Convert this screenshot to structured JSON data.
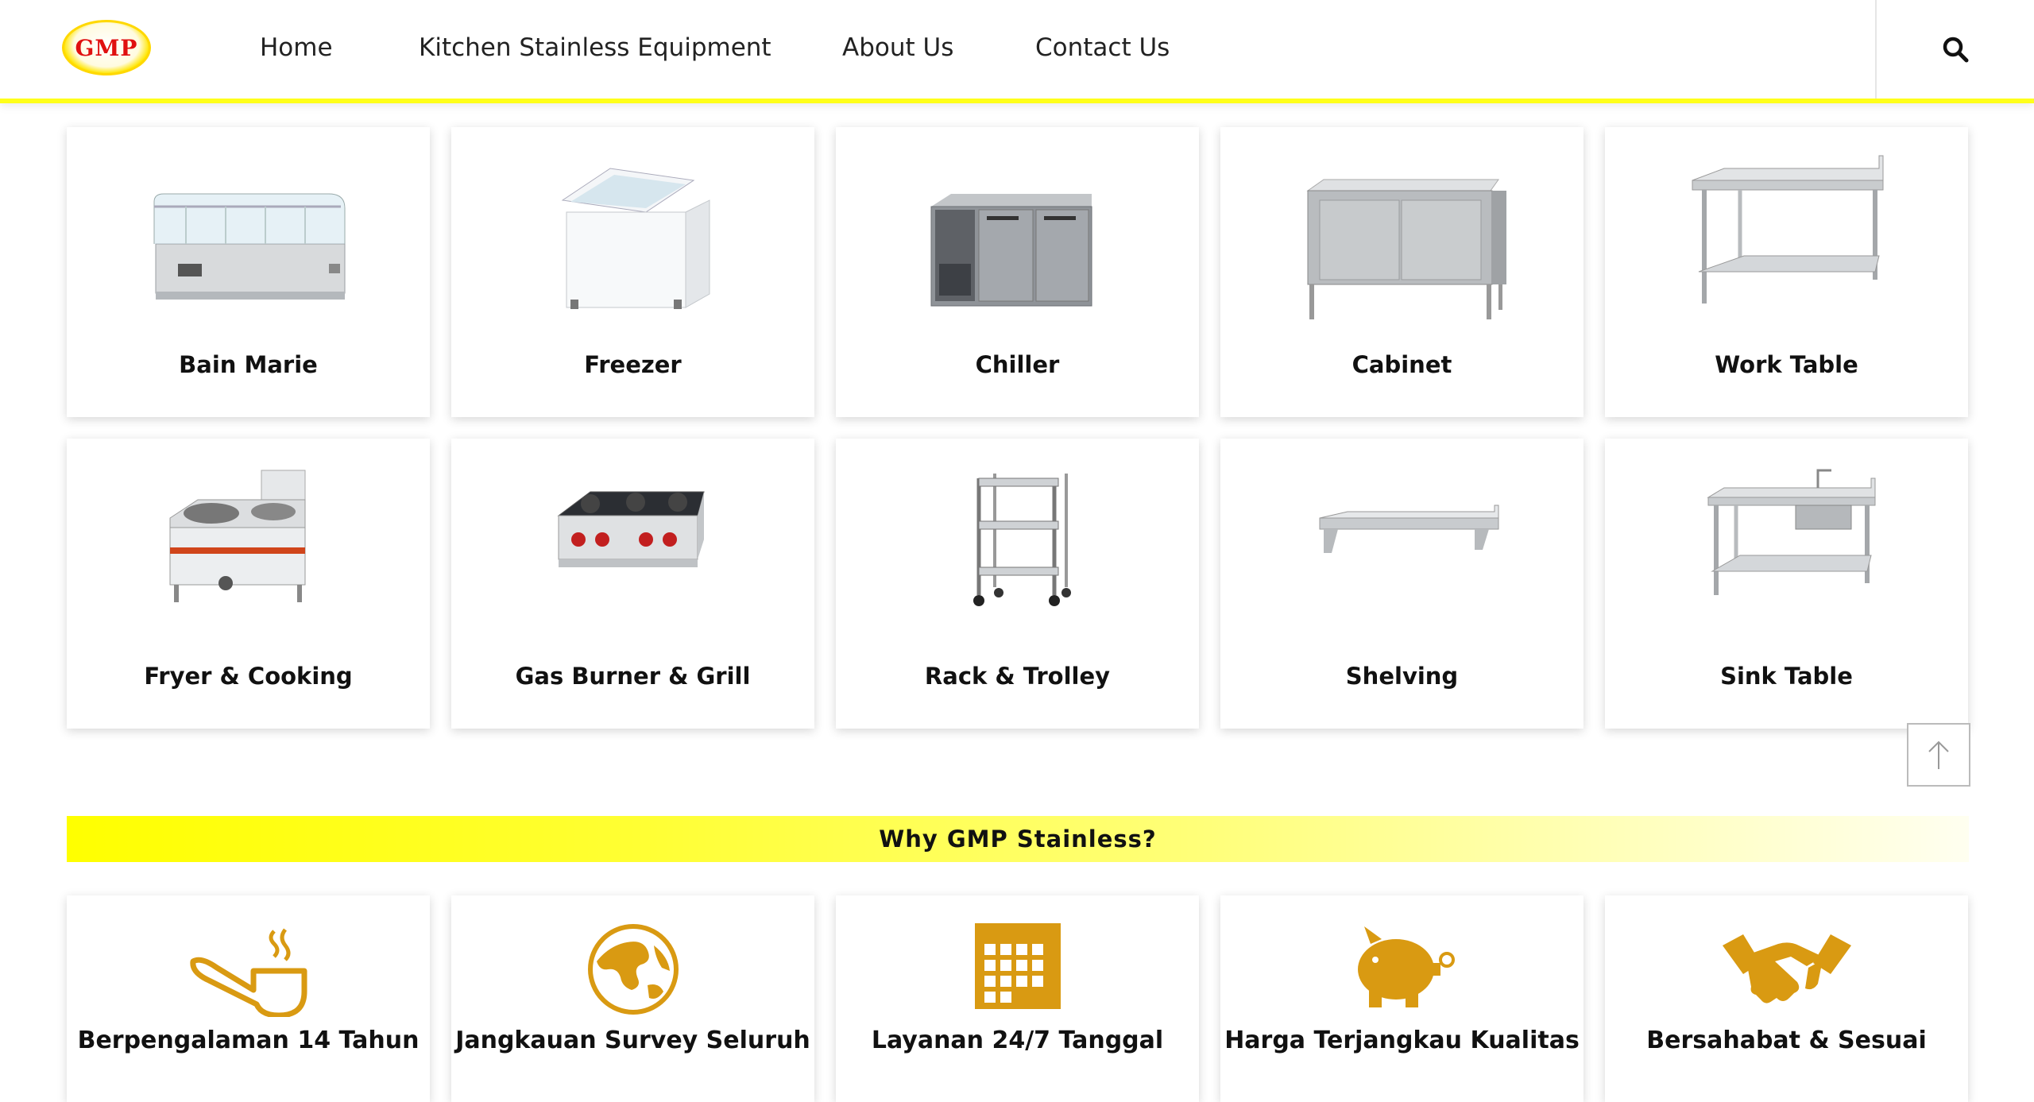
{
  "header": {
    "logo_text": "GMP",
    "nav": {
      "home": "Home",
      "kitchen": "Kitchen Stainless Equipment",
      "about": "About Us",
      "contact": "Contact Us"
    },
    "search_icon": "search-icon",
    "accent_color": "#ffff1a"
  },
  "products": {
    "bain_marie": "Bain Marie",
    "freezer": "Freezer",
    "chiller": "Chiller",
    "cabinet": "Cabinet",
    "work_table": "Work Table",
    "fryer": "Fryer & Cooking",
    "gas_burner": "Gas Burner & Grill",
    "rack_trolley": "Rack & Trolley",
    "shelving": "Shelving",
    "sink_table": "Sink Table"
  },
  "why": {
    "title": "Why GMP Stainless?",
    "icon_color": "#d99a12",
    "items": {
      "experience": "Berpengalaman 14 Tahun",
      "survey": "Jangkauan Survey Seluruh",
      "service": "Layanan 24/7 Tanggal",
      "price": "Harga Terjangkau Kualitas",
      "partner": "Bersahabat & Sesuai"
    }
  },
  "back_to_top_icon": "arrow-up-icon"
}
